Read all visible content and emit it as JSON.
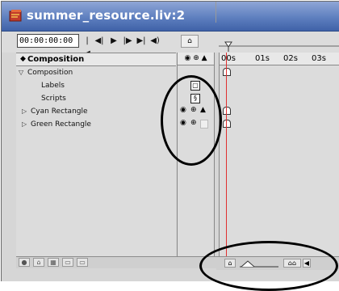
{
  "window": {
    "title": "summer_resource.liv:2"
  },
  "toolbar": {
    "timecode": "00:00:00:00",
    "transport": [
      "go-to-start",
      "previous-frame",
      "play",
      "next-frame",
      "go-to-end",
      "audio"
    ]
  },
  "layers_panel": {
    "column_header": "Composition",
    "rows": [
      {
        "label": "Composition",
        "indent": 0,
        "disclosure": "open"
      },
      {
        "label": "Labels",
        "indent": 2,
        "disclosure": "none"
      },
      {
        "label": "Scripts",
        "indent": 2,
        "disclosure": "none"
      },
      {
        "label": "Cyan Rectangle",
        "indent": 1,
        "disclosure": "closed"
      },
      {
        "label": "Green Rectangle",
        "indent": 1,
        "disclosure": "closed"
      }
    ]
  },
  "timeline": {
    "ruler_labels": [
      "00s",
      "01s",
      "02s",
      "03s"
    ]
  },
  "colors": {
    "titlebar": "#5e7fbf",
    "playhead": "#e03030",
    "panel_bg": "#dcdcdc"
  }
}
